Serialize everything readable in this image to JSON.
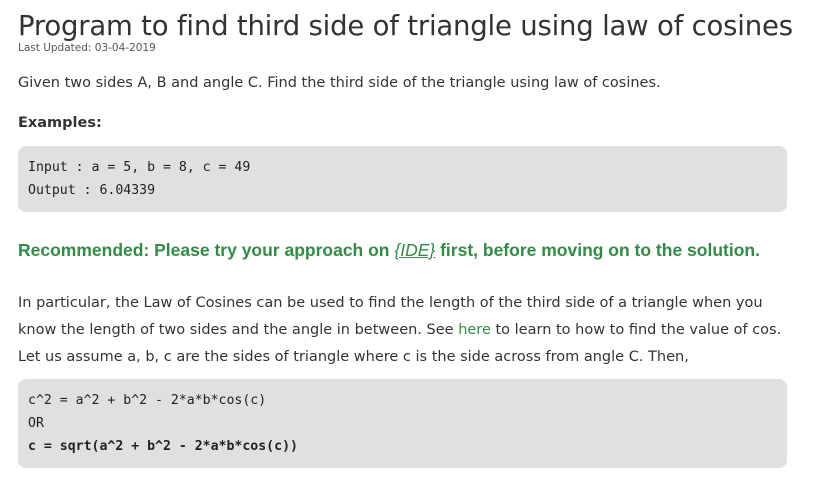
{
  "article": {
    "title": "Program to find third side of triangle using law of cosines",
    "last_updated": "Last Updated: 03-04-2019",
    "intro": "Given two sides A, B and angle C. Find the third side of the triangle using law of cosines.",
    "examples_heading": "Examples:",
    "example_lines": [
      "Input : a = 5, b = 8, c = 49",
      "Output : 6.04339"
    ],
    "recommend_before": "Recommended: Please try your approach on ",
    "recommend_link": "{IDE}",
    "recommend_after": " first, before moving on to the solution.",
    "para1_before": "In particular, the Law of Cosines can be used to find the length of the third side of a triangle when you know the length of two sides and the angle in between. See ",
    "para1_link": "here",
    "para1_after": " to learn to how to find the value of cos.",
    "para2": "Let us assume a, b, c are the sides of triangle where c is the side across from angle C. Then,",
    "formula_lines": [
      "c^2 = a^2 + b^2 - 2*a*b*cos(c)",
      "OR"
    ],
    "formula_bold": "c = sqrt(a^2 + b^2 - 2*a*b*cos(c))"
  },
  "colors": {
    "accent": "#2f8d46",
    "code_bg": "#e0e0e0",
    "text": "#333333"
  }
}
